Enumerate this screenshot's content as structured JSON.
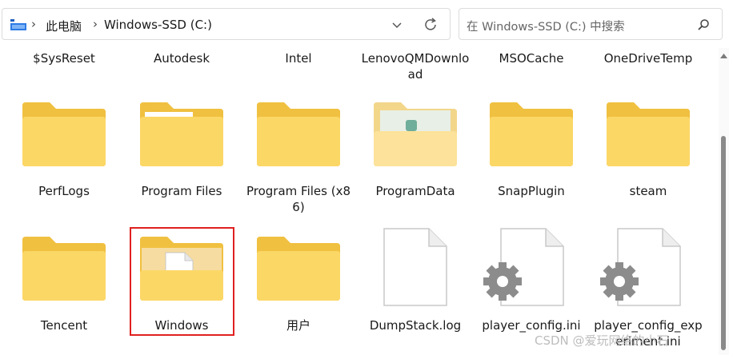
{
  "address_bar": {
    "crumbs": [
      "此电脑",
      "Windows-SSD (C:)"
    ]
  },
  "search": {
    "placeholder": "在 Windows-SSD (C:) 中搜索"
  },
  "top_row": [
    "$SysReset",
    "Autodesk",
    "Intel",
    "LenovoQMDownload",
    "MSOCache",
    "OneDriveTemp"
  ],
  "row2": [
    {
      "label": "PerfLogs",
      "icon": "folder-icon"
    },
    {
      "label": "Program Files",
      "icon": "folder-icon"
    },
    {
      "label": "Program Files (x86)",
      "icon": "folder-icon"
    },
    {
      "label": "ProgramData",
      "icon": "folder-icon"
    },
    {
      "label": "SnapPlugin",
      "icon": "folder-icon"
    },
    {
      "label": "steam",
      "icon": "folder-icon"
    }
  ],
  "row3": [
    {
      "label": "Tencent",
      "icon": "folder-icon"
    },
    {
      "label": "Windows",
      "icon": "folder-icon"
    },
    {
      "label": "用户",
      "icon": "folder-icon"
    },
    {
      "label": "DumpStack.log",
      "icon": "file-icon"
    },
    {
      "label": "player_config.ini",
      "icon": "config-file-icon"
    },
    {
      "label": "player_config_experiment.ini",
      "icon": "config-file-icon"
    }
  ],
  "selected_item": "Windows",
  "colors": {
    "folder_back": "#f0c040",
    "folder_front": "#fbd766",
    "selection": "#e02020"
  },
  "watermark": "CSDN @爱玩网络的小石"
}
